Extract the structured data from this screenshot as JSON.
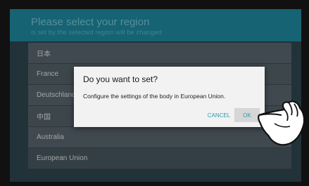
{
  "header": {
    "title": "Please select your region",
    "subtitle": "is set by the selected region will be changed"
  },
  "regions": [
    "日本",
    "France",
    "Deutschland",
    "中国",
    "Australia",
    "European Union"
  ],
  "dialog": {
    "title": "Do you want to set?",
    "message": "Configure the settings of the body in European Union.",
    "cancel_label": "CANCEL",
    "ok_label": "OK"
  },
  "icons": {
    "pointer": "pointing-hand-icon"
  },
  "colors": {
    "accent": "#2e9bb0",
    "header": "#1e8aa0",
    "dialog_bg": "#f2f2f2"
  }
}
